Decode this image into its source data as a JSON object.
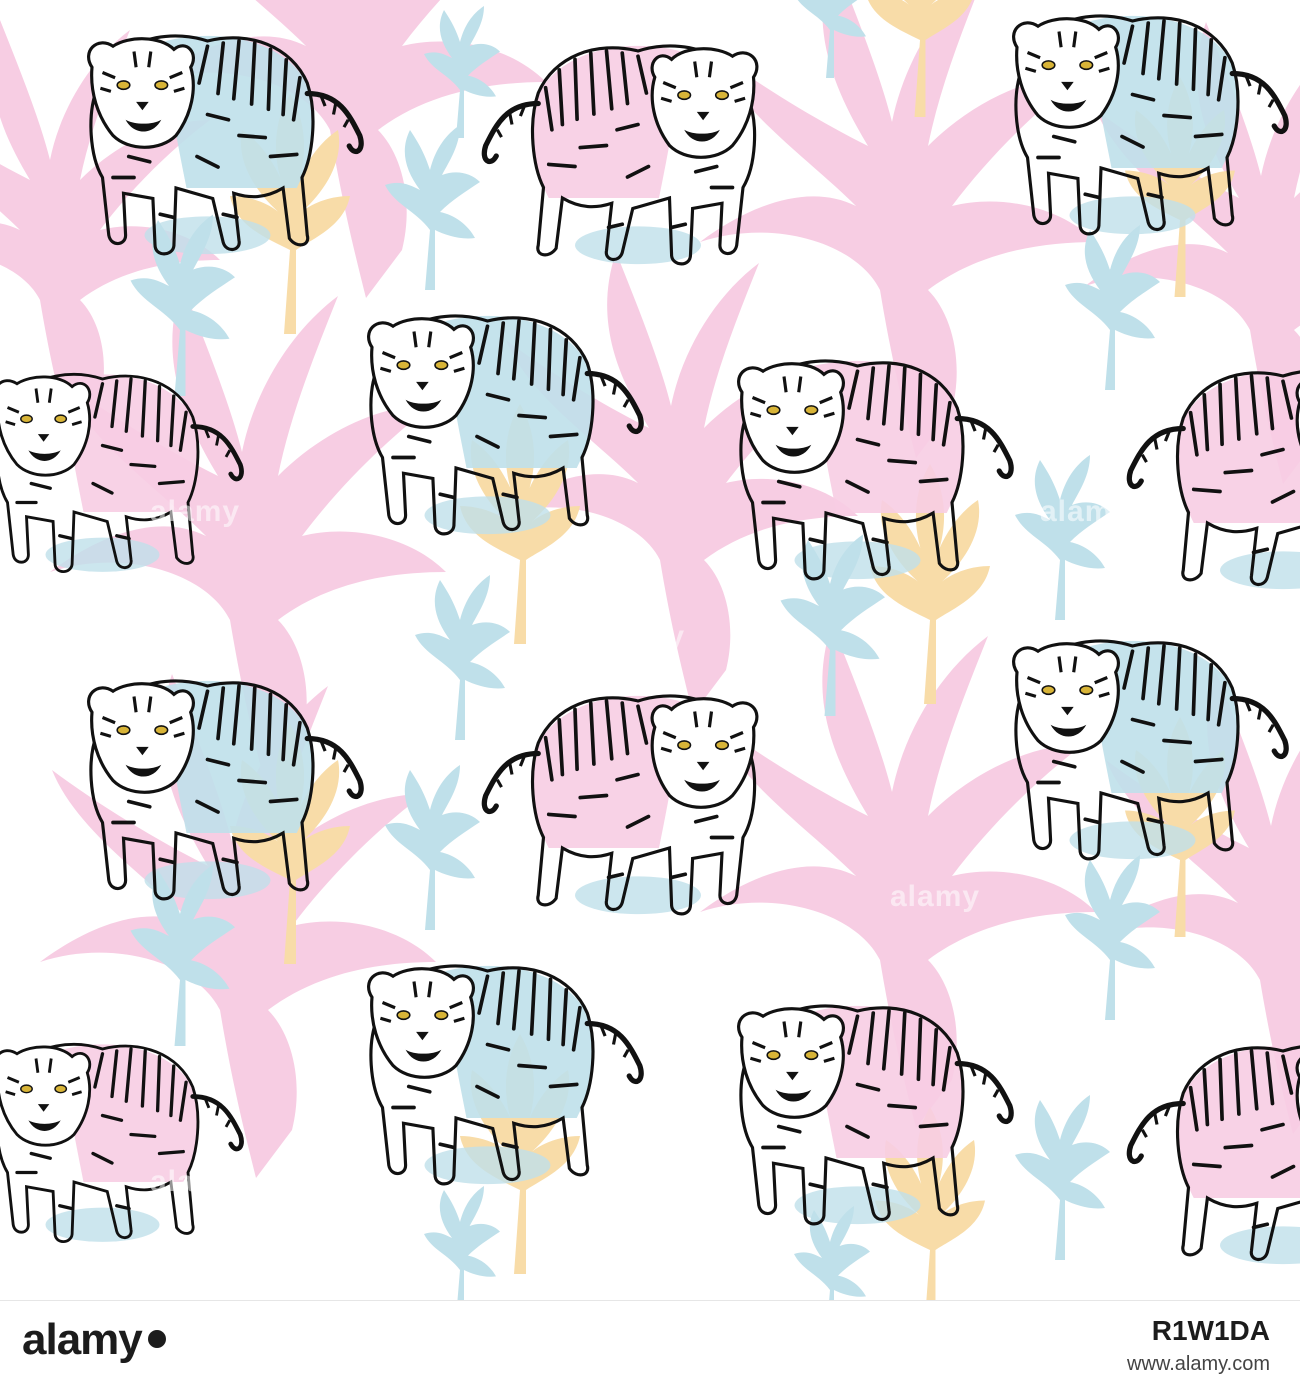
{
  "image": {
    "subject": "Seamless pattern of line-drawn tigers with pastel pink, blue and yellow tropical leaves on white",
    "colors": {
      "background": "#ffffff",
      "pink": "#f7cde3",
      "blue": "#bfe0ea",
      "yellow": "#f8dca8",
      "ink": "#111111",
      "eye": "#d8b437"
    }
  },
  "watermark": {
    "text": "alamy"
  },
  "footer": {
    "logo": "alamy",
    "image_id": "R1W1DA",
    "url": "www.alamy.com"
  }
}
